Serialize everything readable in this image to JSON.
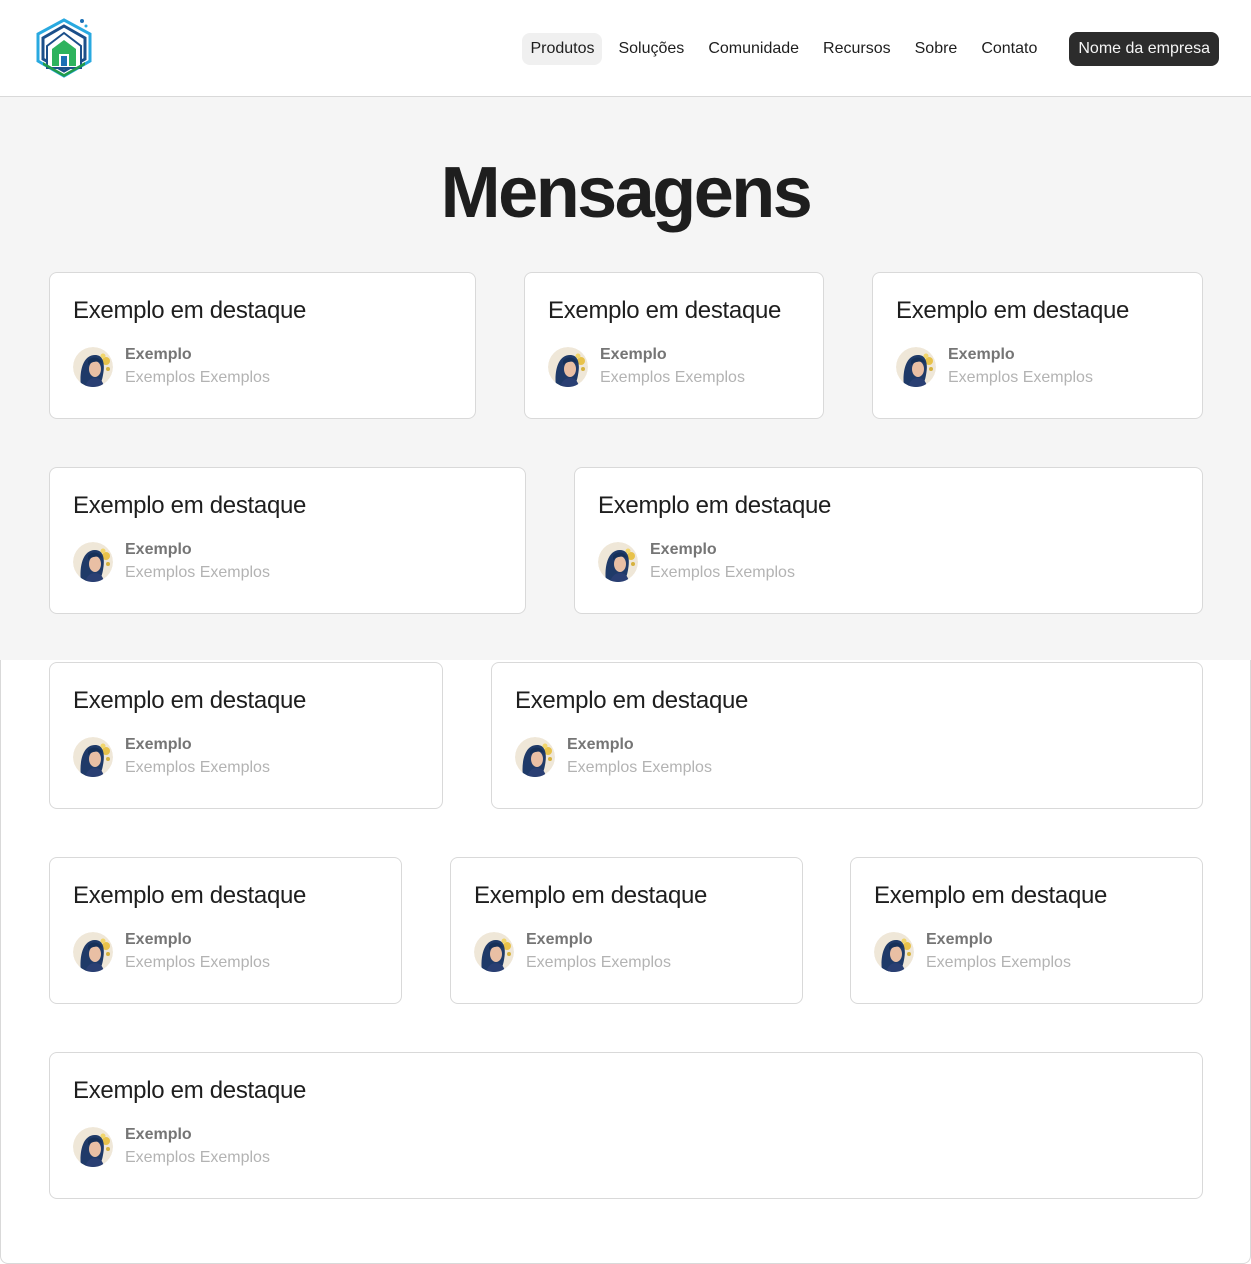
{
  "header": {
    "logo": "house-logo-icon",
    "nav": [
      "Produtos",
      "Soluções",
      "Comunidade",
      "Recursos",
      "Sobre",
      "Contato"
    ],
    "active_nav": "Produtos",
    "cta_label": "Nome da empresa"
  },
  "hero": {
    "title": "Mensagens"
  },
  "cards": [
    {
      "title": "Exemplo em destaque",
      "name": "Exemplo",
      "description": "Exemplos Exemplos",
      "avatar": "user-avatar-icon"
    },
    {
      "title": "Exemplo em destaque",
      "name": "Exemplo",
      "description": "Exemplos Exemplos",
      "avatar": "user-avatar-icon"
    },
    {
      "title": "Exemplo em destaque",
      "name": "Exemplo",
      "description": "Exemplos Exemplos",
      "avatar": "user-avatar-icon"
    },
    {
      "title": "Exemplo em destaque",
      "name": "Exemplo",
      "description": "Exemplos Exemplos",
      "avatar": "user-avatar-icon"
    },
    {
      "title": "Exemplo em destaque",
      "name": "Exemplo",
      "description": "Exemplos Exemplos",
      "avatar": "user-avatar-icon"
    },
    {
      "title": "Exemplo em destaque",
      "name": "Exemplo",
      "description": "Exemplos Exemplos",
      "avatar": "user-avatar-icon"
    },
    {
      "title": "Exemplo em destaque",
      "name": "Exemplo",
      "description": "Exemplos Exemplos",
      "avatar": "user-avatar-icon"
    },
    {
      "title": "Exemplo em destaque",
      "name": "Exemplo",
      "description": "Exemplos Exemplos",
      "avatar": "user-avatar-icon"
    },
    {
      "title": "Exemplo em destaque",
      "name": "Exemplo",
      "description": "Exemplos Exemplos",
      "avatar": "user-avatar-icon"
    },
    {
      "title": "Exemplo em destaque",
      "name": "Exemplo",
      "description": "Exemplos Exemplos",
      "avatar": "user-avatar-icon"
    },
    {
      "title": "Exemplo em destaque",
      "name": "Exemplo",
      "description": "Exemplos Exemplos",
      "avatar": "user-avatar-icon"
    }
  ],
  "colors": {
    "hero_background": "#f5f5f5",
    "cta_background": "#2c2c2c",
    "text_primary": "#1e1e1e",
    "text_secondary": "#757575",
    "text_tertiary": "#b3b3b3",
    "logo_blue": "#1b6fb5",
    "logo_green": "#1f9a4b"
  }
}
